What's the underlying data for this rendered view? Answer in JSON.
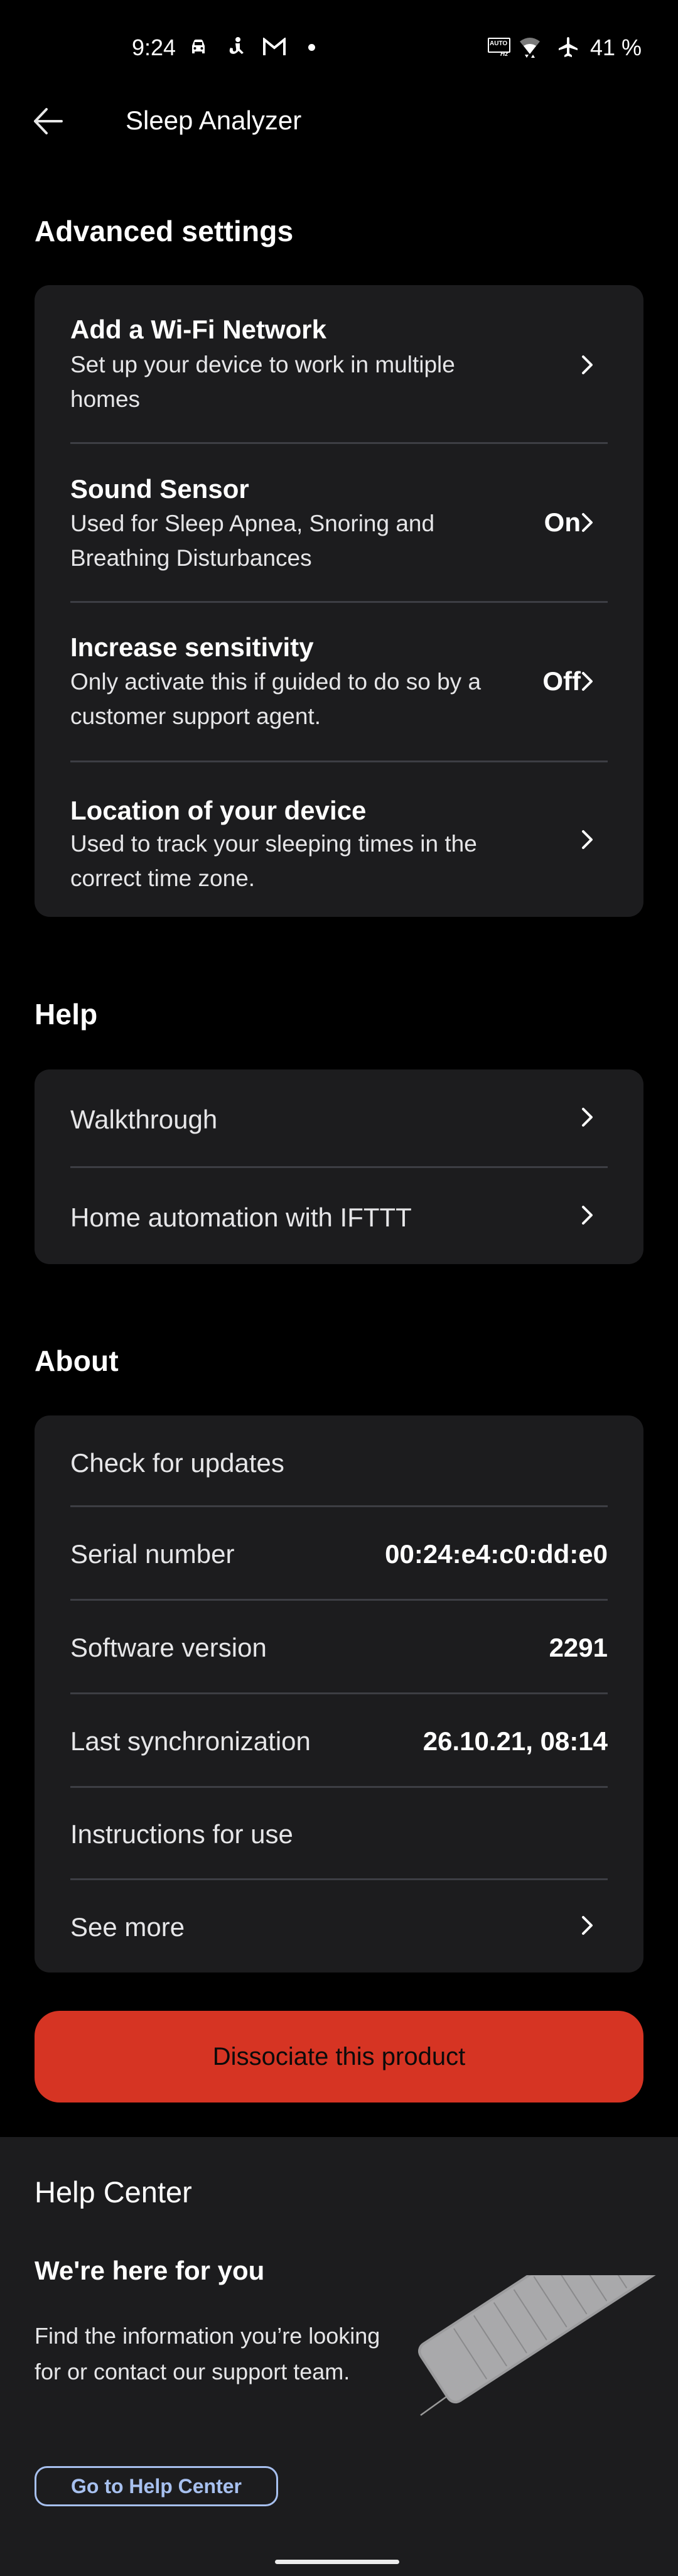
{
  "status_bar": {
    "time": "9:24",
    "left_icons": [
      "car-icon",
      "accessibility-figure-icon",
      "gmail-icon",
      "notification-dot-icon"
    ],
    "right_icons": [
      "auto-hz-icon",
      "wifi-icon",
      "airplane-mode-icon"
    ],
    "auto_hz_label_top": "AUTO",
    "auto_hz_label_bottom": "Hz",
    "battery": "41 %"
  },
  "header": {
    "back_icon": "arrow-left-icon",
    "title": "Sleep Analyzer"
  },
  "advanced_settings": {
    "heading": "Advanced settings",
    "items": [
      {
        "title": "Add a Wi-Fi Network",
        "subtitle": "Set up your device to work in multiple homes",
        "value": "",
        "icon": "chevron-right-icon"
      },
      {
        "title": "Sound Sensor",
        "subtitle": "Used for Sleep Apnea, Snoring and Breathing Disturbances",
        "value": "On",
        "icon": "chevron-right-icon"
      },
      {
        "title": "Increase sensitivity",
        "subtitle": "Only activate this if guided to do so by a customer support agent.",
        "value": "Off",
        "icon": "chevron-right-icon"
      },
      {
        "title": "Location of your device",
        "subtitle": "Used to track your sleeping times in the correct time zone.",
        "value": "",
        "icon": "chevron-right-icon"
      }
    ]
  },
  "help": {
    "heading": "Help",
    "items": [
      {
        "label": "Walkthrough",
        "icon": "chevron-right-icon"
      },
      {
        "label": "Home automation with IFTTT",
        "icon": "chevron-right-icon"
      }
    ]
  },
  "about": {
    "heading": "About",
    "items": [
      {
        "label": "Check for updates",
        "value": ""
      },
      {
        "label": "Serial number",
        "value": "00:24:e4:c0:dd:e0"
      },
      {
        "label": "Software version",
        "value": "2291"
      },
      {
        "label": "Last synchronization",
        "value": "26.10.21, 08:14"
      },
      {
        "label": "Instructions for use",
        "value": ""
      },
      {
        "label": "See more",
        "value": "",
        "icon": "chevron-right-icon"
      }
    ]
  },
  "dissociate_button": {
    "label": "Dissociate this product",
    "color": "#d63423"
  },
  "help_center": {
    "title": "Help Center",
    "subtitle": "We're here for you",
    "body": "Find the information you’re looking for or contact our support team.",
    "button_label": "Go to Help Center",
    "button_color": "#a7c0ef",
    "image": "sleep-analyzer-mat-image"
  },
  "colors": {
    "background": "#000000",
    "card": "#1c1c1e",
    "divider": "#3d3e44"
  }
}
